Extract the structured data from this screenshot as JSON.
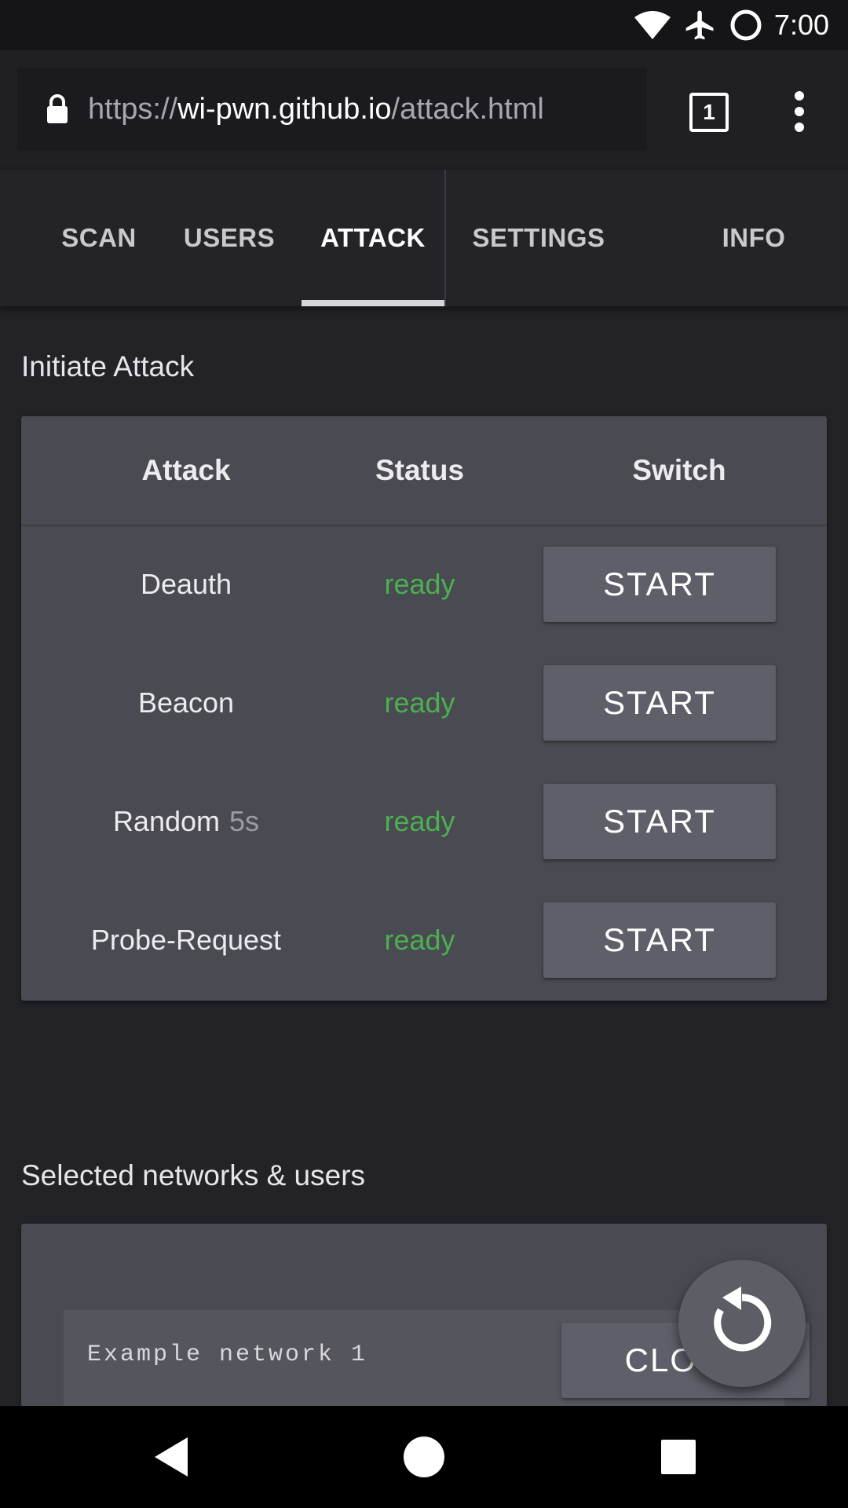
{
  "status_bar": {
    "time": "7:00",
    "icons": [
      "wifi-icon",
      "airplane-icon",
      "sync-circle-icon"
    ]
  },
  "browser": {
    "url_scheme": "https://",
    "url_host": "wi-pwn.github.io",
    "url_path": "/attack.html",
    "tab_count": "1"
  },
  "nav": {
    "tabs": [
      {
        "label": "SCAN",
        "active": false
      },
      {
        "label": "USERS",
        "active": false
      },
      {
        "label": "ATTACK",
        "active": true
      },
      {
        "label": "SETTINGS",
        "active": false
      },
      {
        "label": "INFO",
        "active": false
      }
    ]
  },
  "attack_section": {
    "title": "Initiate Attack",
    "headers": [
      "Attack",
      "Status",
      "Switch"
    ],
    "rows": [
      {
        "name": "Deauth",
        "suffix": "",
        "status": "ready",
        "button": "START"
      },
      {
        "name": "Beacon",
        "suffix": "",
        "status": "ready",
        "button": "START"
      },
      {
        "name": "Random",
        "suffix": "5s",
        "status": "ready",
        "button": "START"
      },
      {
        "name": "Probe-Request",
        "suffix": "",
        "status": "ready",
        "button": "START"
      }
    ]
  },
  "selected_section": {
    "title": "Selected networks & users",
    "networks": [
      {
        "name": "Example network 1",
        "button": "CLONE"
      }
    ]
  },
  "colors": {
    "ready": "#4caf50",
    "background": "#222227",
    "card": "#4a4a52",
    "button": "#5f5f6a"
  }
}
